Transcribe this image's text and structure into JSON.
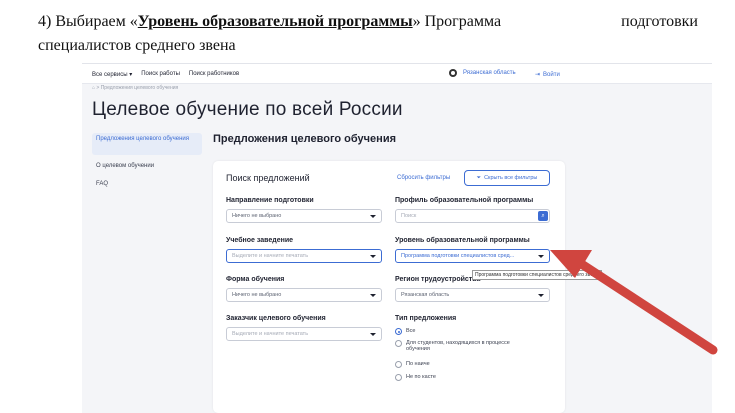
{
  "instruction": {
    "prefix": "4) Выбираем «",
    "highlight": "Уровень образовательной программы",
    "suffix_word1": "» Программа",
    "suffix_word2": "подготовки",
    "line2": "специалистов среднего звена"
  },
  "topbar": {
    "nav": [
      "Все сервисы ▾",
      "Поиск работы",
      "Поиск работников"
    ],
    "region": "Рязанская область",
    "login": "Войти"
  },
  "breadcrumb": "⌂  >  Предложения целевого обучения",
  "page_title": "Целевое обучение по всей России",
  "sidebar": {
    "items": [
      {
        "label": "Предложения целевого обучения"
      },
      {
        "label": "О целевом обучении"
      },
      {
        "label": "FAQ"
      }
    ]
  },
  "section_title": "Предложения целевого обучения",
  "card": {
    "title": "Поиск предложений",
    "reset": "Сбросить фильтры",
    "hide_filters": "Скрыть все фильтры",
    "fields": {
      "direction": {
        "label": "Направление подготовки",
        "value": "Ничего не выбрано"
      },
      "profile": {
        "label": "Профиль образовательной программы",
        "placeholder": "Поиск"
      },
      "institution": {
        "label": "Учебное заведение",
        "placeholder": "Выделите и начните печатать"
      },
      "level": {
        "label": "Уровень образовательной программы",
        "value": "Программа подготовки специалистов сред..."
      },
      "form": {
        "label": "Форма обучения",
        "value": "Ничего не выбрано"
      },
      "region": {
        "label": "Регион трудоустройства",
        "value": "Рязанская область"
      },
      "customer": {
        "label": "Заказчик целевого обучения",
        "placeholder": "Выделите и начните печатать"
      },
      "offer_type": {
        "label": "Тип предложения",
        "options": [
          {
            "label": "Все",
            "selected": true
          },
          {
            "label": "Для студентов, находящихся в процессе обучения",
            "selected": false
          },
          {
            "label": "По наиче",
            "selected": false
          },
          {
            "label": "Не по касте",
            "selected": false
          }
        ]
      }
    }
  },
  "tooltip": "Программа подготовки специалистов среднего звена",
  "colors": {
    "accent": "#3c6cd3",
    "arrow": "#d0453f"
  }
}
